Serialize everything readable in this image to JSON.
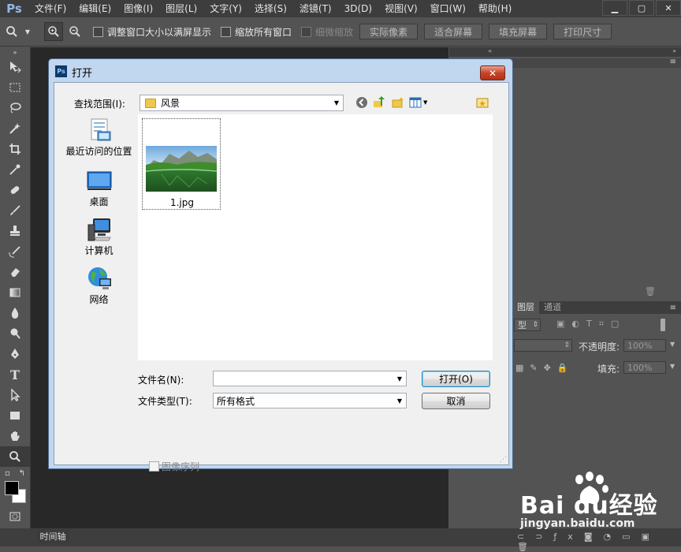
{
  "app": {
    "logo": "Ps"
  },
  "menubar": {
    "items": [
      "文件(F)",
      "编辑(E)",
      "图像(I)",
      "图层(L)",
      "文字(Y)",
      "选择(S)",
      "滤镜(T)",
      "3D(D)",
      "视图(V)",
      "窗口(W)",
      "帮助(H)"
    ]
  },
  "options": {
    "resize_windows": "调整窗口大小以满屏显示",
    "zoom_all": "缩放所有窗口",
    "scrubby_zoom": "细微缩放",
    "actual_pixels": "实际像素",
    "fit_screen": "适合屏幕",
    "fill_screen": "填充屏幕",
    "print_size": "打印尺寸"
  },
  "panels": {
    "layers_tab": "图层",
    "channels_tab": "通道",
    "kind": "型",
    "opacity_label": "不透明度:",
    "opacity_value": "100%",
    "fill_label": "填充:",
    "fill_value": "100%"
  },
  "timeline": {
    "label": "时间轴"
  },
  "dialog": {
    "icon_text": "Ps",
    "title": "打开",
    "lookin_label": "查找范围(I):",
    "lookin_value": "风景",
    "places": [
      {
        "label": "最近访问的位置"
      },
      {
        "label": "桌面"
      },
      {
        "label": "计算机"
      },
      {
        "label": "网络"
      }
    ],
    "files": [
      {
        "name": "1.jpg"
      }
    ],
    "filename_label": "文件名(N):",
    "filename_value": "",
    "filetype_label": "文件类型(T):",
    "filetype_value": "所有格式",
    "open_button": "打开(O)",
    "cancel_button": "取消",
    "image_sequence": "图像序列"
  },
  "watermark": {
    "text": "Bai du经验",
    "url": "jingyan.baidu.com"
  },
  "colors": {
    "ps_bg": "#535353",
    "dialog_frame": "#c1d6ef",
    "close_red": "#c7452a",
    "default_button_border": "#3c7fb1"
  }
}
